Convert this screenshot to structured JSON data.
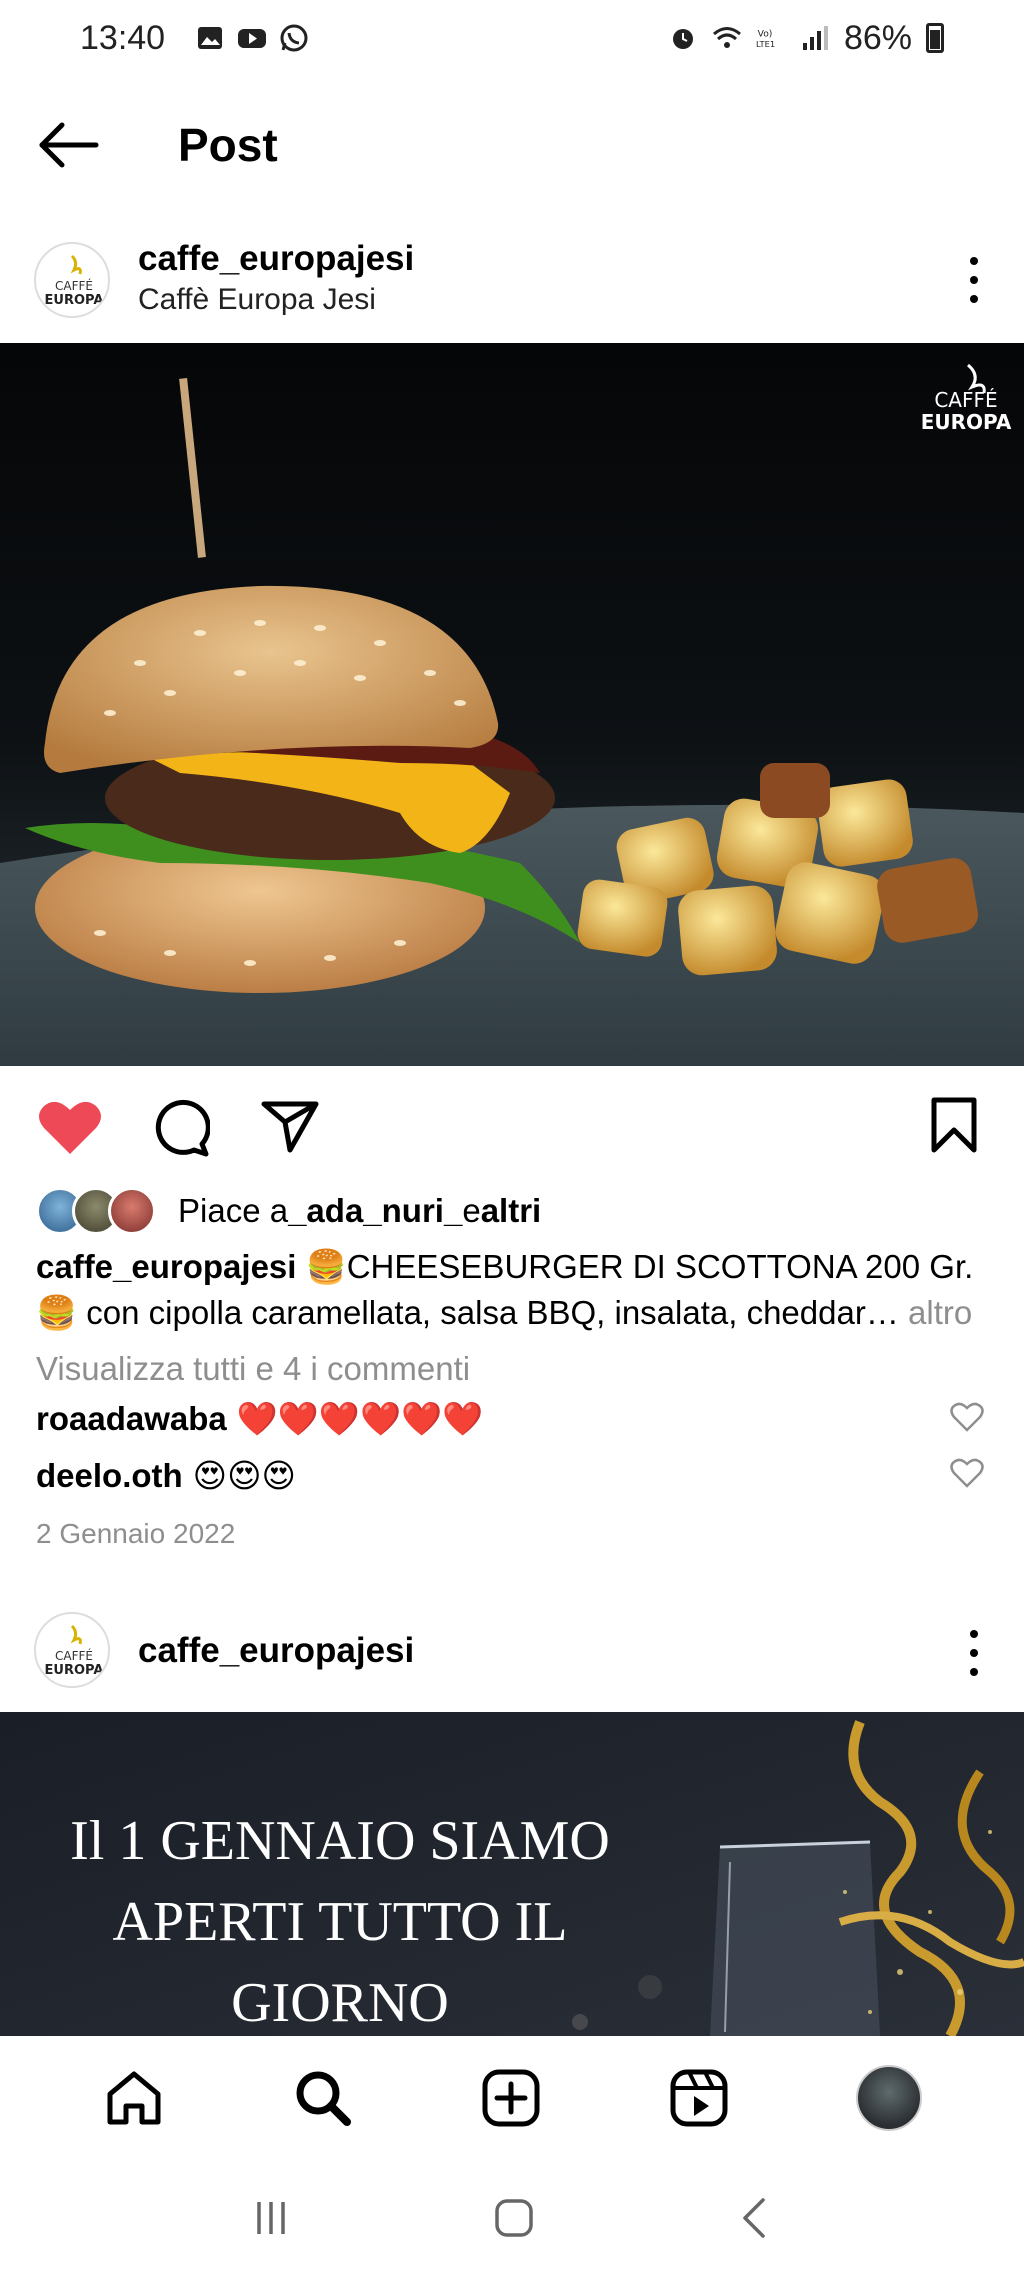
{
  "status_bar": {
    "time": "13:40",
    "battery": "86%"
  },
  "app_bar": {
    "title": "Post"
  },
  "post1": {
    "username": "caffe_europajesi",
    "display_name": "Caffè Europa Jesi",
    "watermark_top": "CAFFÉ",
    "watermark_bottom": "EUROPA",
    "liked": true,
    "likes_prefix": "Piace a ",
    "likes_user": "_ada_nuri_",
    "likes_mid": " e ",
    "likes_suffix": "altri",
    "caption_user": "caffe_europajesi",
    "caption_text": "🍔CHEESEBURGER DI SCOTTONA 200 Gr. 🍔 con cipolla caramellata, salsa BBQ, insalata, cheddar…",
    "caption_more": " altro",
    "view_all": "Visualizza tutti e 4 i commenti",
    "comments": [
      {
        "user": "roaadawaba",
        "text": "❤️❤️❤️❤️❤️❤️"
      },
      {
        "user": "deelo.oth",
        "text": "😍😍😍"
      }
    ],
    "date": "2 Gennaio 2022"
  },
  "post2": {
    "username": "caffe_europajesi",
    "headline_1": "Il 1 GENNAIO SIAMO",
    "headline_2": "APERTI TUTTO IL",
    "headline_3": "GIORNO"
  },
  "colors": {
    "like_red": "#ed4956",
    "muted": "#8e8e8e"
  }
}
